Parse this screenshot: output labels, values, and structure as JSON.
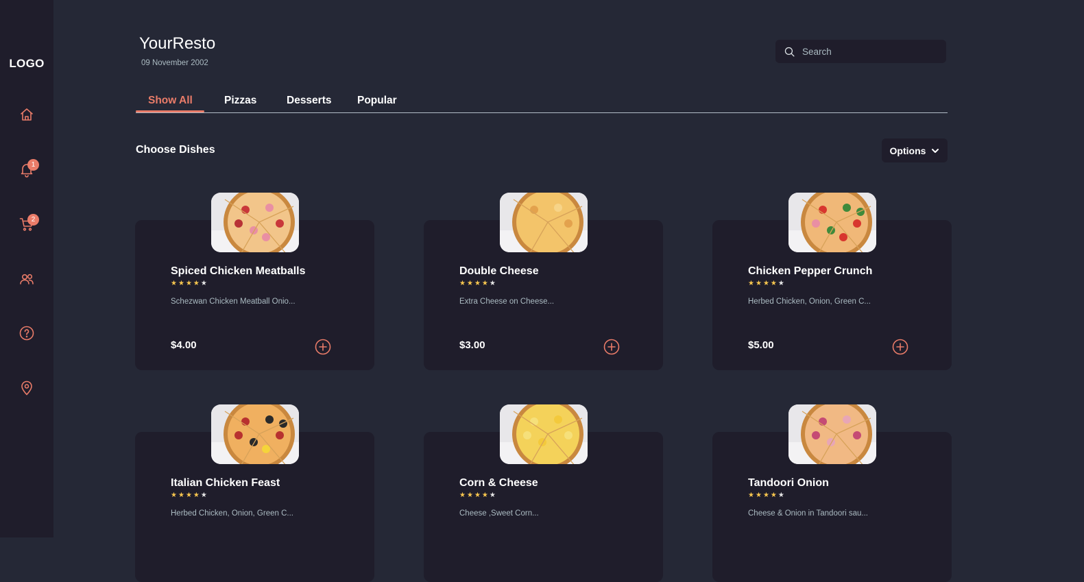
{
  "sidebar": {
    "logo": "LOGO",
    "items": [
      {
        "name": "home",
        "icon": "home-icon"
      },
      {
        "name": "notifications",
        "icon": "bell-icon",
        "badge": "1"
      },
      {
        "name": "cart",
        "icon": "cart-icon",
        "badge": "2"
      },
      {
        "name": "users",
        "icon": "users-icon"
      },
      {
        "name": "help",
        "icon": "help-icon"
      },
      {
        "name": "location",
        "icon": "location-pin-icon"
      }
    ]
  },
  "header": {
    "title": "YourResto",
    "date": "09 November 2002",
    "search_placeholder": "Search"
  },
  "tabs": [
    {
      "label": "Show All",
      "active": true
    },
    {
      "label": "Pizzas",
      "active": false
    },
    {
      "label": "Desserts",
      "active": false
    },
    {
      "label": "Popular",
      "active": false
    }
  ],
  "section": {
    "title": "Choose Dishes",
    "options_label": "Options"
  },
  "colors": {
    "accent": "#ea7c69",
    "background": "#252836",
    "panel": "#1f1d2b",
    "star": "#f9c74f",
    "muted_text": "#abbbc2"
  },
  "dishes": [
    {
      "name": "Spiced Chicken Meatballs",
      "rating": 4,
      "max_rating": 5,
      "description": "Schezwan Chicken Meatball Onio...",
      "price": "$4.00"
    },
    {
      "name": "Double Cheese",
      "rating": 4,
      "max_rating": 5,
      "description": "Extra Cheese on Cheese...",
      "price": "$3.00"
    },
    {
      "name": "Chicken Pepper Crunch",
      "rating": 4,
      "max_rating": 5,
      "description": "Herbed Chicken, Onion, Green C...",
      "price": "$5.00"
    },
    {
      "name": "Italian Chicken Feast",
      "rating": 4,
      "max_rating": 5,
      "description": "Herbed Chicken, Onion, Green C...",
      "price": ""
    },
    {
      "name": "Corn & Cheese",
      "rating": 4,
      "max_rating": 5,
      "description": "Cheese ,Sweet Corn...",
      "price": ""
    },
    {
      "name": "Tandoori Onion",
      "rating": 4,
      "max_rating": 5,
      "description": "Cheese & Onion in Tandoori sau...",
      "price": ""
    }
  ]
}
